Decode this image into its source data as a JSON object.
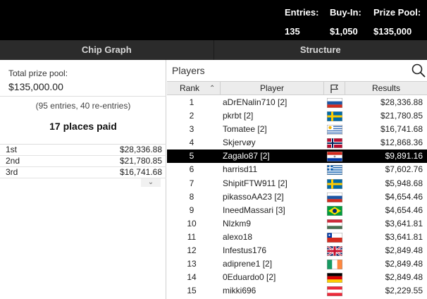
{
  "header": {
    "entries_label": "Entries:",
    "entries_value": "135",
    "buyin_label": "Buy-In:",
    "buyin_value": "$1,050",
    "prizepool_label": "Prize Pool:",
    "prizepool_value": "$135,000"
  },
  "tabs": [
    {
      "label": "Chip Graph"
    },
    {
      "label": "Structure"
    }
  ],
  "prize_panel": {
    "total_label": "Total prize pool:",
    "total_value": "$135,000.00",
    "entries_note": "(95 entries, 40 re-entries)",
    "places_paid": "17 places paid",
    "payouts": [
      {
        "place": "1st",
        "amount": "$28,336.88"
      },
      {
        "place": "2nd",
        "amount": "$21,780.85"
      },
      {
        "place": "3rd",
        "amount": "$16,741.68"
      }
    ],
    "collapse_icon": "chevron-down-icon"
  },
  "players": {
    "title": "Players",
    "search_icon": "search-icon",
    "columns": {
      "rank": "Rank",
      "player": "Player",
      "flag_icon": "flag-icon",
      "results": "Results"
    },
    "selected_rank": 5,
    "rows": [
      {
        "rank": "1",
        "name": "aDrENalin710 [2]",
        "country": "Russia",
        "result": "$28,336.88"
      },
      {
        "rank": "2",
        "name": "pkrbt [2]",
        "country": "Sweden",
        "result": "$21,780.85"
      },
      {
        "rank": "3",
        "name": "Tomatee [2]",
        "country": "Uruguay",
        "result": "$16,741.68"
      },
      {
        "rank": "4",
        "name": "Skjervøy",
        "country": "Norway",
        "result": "$12,868.36"
      },
      {
        "rank": "5",
        "name": "Zagalo87 [2]",
        "country": "Paraguay",
        "result": "$9,891.16"
      },
      {
        "rank": "6",
        "name": "harrisd11",
        "country": "Greece",
        "result": "$7,602.76"
      },
      {
        "rank": "7",
        "name": "ShipitFTW911 [2]",
        "country": "Sweden",
        "result": "$5,948.68"
      },
      {
        "rank": "8",
        "name": "pikassoAA23 [2]",
        "country": "Russia",
        "result": "$4,654.46"
      },
      {
        "rank": "9",
        "name": "IneedMassari [3]",
        "country": "Brazil",
        "result": "$4,654.46"
      },
      {
        "rank": "10",
        "name": "Nlzkm9",
        "country": "Hungary",
        "result": "$3,641.81"
      },
      {
        "rank": "11",
        "name": "alexo18",
        "country": "Chile",
        "result": "$3,641.81"
      },
      {
        "rank": "12",
        "name": "Infestus176",
        "country": "United Kingdom",
        "result": "$2,849.48"
      },
      {
        "rank": "13",
        "name": "adiprene1 [2]",
        "country": "Ireland",
        "result": "$2,849.48"
      },
      {
        "rank": "14",
        "name": "0Eduardo0 [2]",
        "country": "Germany",
        "result": "$2,849.48"
      },
      {
        "rank": "15",
        "name": "mikki696",
        "country": "Austria",
        "result": "$2,229.55"
      }
    ]
  }
}
